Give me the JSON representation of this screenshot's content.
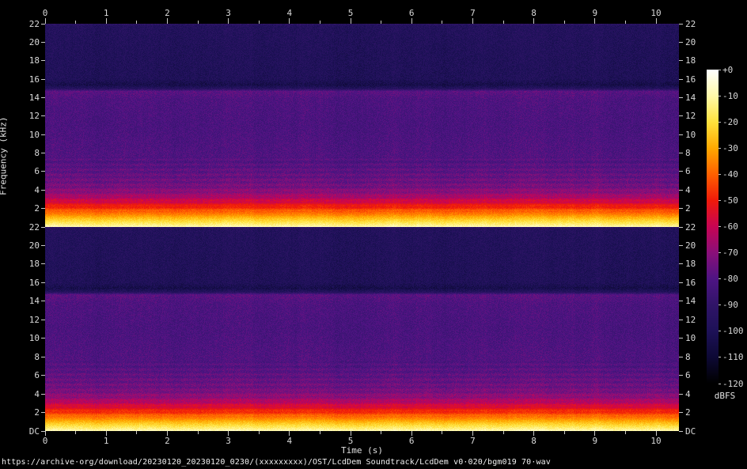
{
  "window": {
    "background": "#000000"
  },
  "status_bar": {
    "url": "https://archive·org/download/20230120_20230120_0230/(xxxxxxxxx)/OST/LcdDem Soundtrack/LcdDem v0·020/bgm019 70·wav"
  },
  "chart_data": {
    "type": "heatmap",
    "subtype": "spectrogram",
    "title": "",
    "xlabel": "Time (s)",
    "ylabel": "Frequency (kHz)",
    "duration_s": 10.38,
    "x_ticks": [
      0,
      1,
      2,
      3,
      4,
      5,
      6,
      7,
      8,
      9,
      10
    ],
    "x_minor_step_s": 0.5,
    "freq_max_khz": 22,
    "channels": [
      {
        "name": "channel-1",
        "y_tick_labels": [
          "22",
          "20",
          "18",
          "16",
          "14",
          "12",
          "10",
          "8",
          "6",
          "4",
          "2"
        ]
      },
      {
        "name": "channel-2",
        "y_tick_labels": [
          "22",
          "20",
          "18",
          "16",
          "14",
          "12",
          "10",
          "8",
          "6",
          "4",
          "2",
          "DC"
        ]
      }
    ],
    "colorbar": {
      "label": "dBFS",
      "max_db": 0,
      "min_db": -120,
      "tick_labels": [
        "+0",
        "-10",
        "-20",
        "-30",
        "-40",
        "-50",
        "-60",
        "-70",
        "-80",
        "-90",
        "-100",
        "-110",
        "-120"
      ]
    },
    "palette_db_colors": [
      [
        -120,
        "#000000"
      ],
      [
        -110,
        "#0d0935"
      ],
      [
        -100,
        "#1d1157"
      ],
      [
        -90,
        "#301468"
      ],
      [
        -80,
        "#4e1483"
      ],
      [
        -70,
        "#8a0f79"
      ],
      [
        -60,
        "#c70453"
      ],
      [
        -50,
        "#ef1a0a"
      ],
      [
        -40,
        "#ff6000"
      ],
      [
        -30,
        "#ffa800"
      ],
      [
        -20,
        "#ffe13c"
      ],
      [
        -10,
        "#fff9a8"
      ],
      [
        0,
        "#ffffff"
      ]
    ],
    "spectral_envelope_khz_db": [
      [
        22.0,
        -93
      ],
      [
        21.8,
        -97
      ],
      [
        16.0,
        -99
      ],
      [
        15.4,
        -104
      ],
      [
        15.0,
        -96
      ],
      [
        14.7,
        -78
      ],
      [
        13.8,
        -81
      ],
      [
        11.0,
        -82
      ],
      [
        7.0,
        -80
      ],
      [
        4.4,
        -74
      ],
      [
        3.5,
        -68
      ],
      [
        2.9,
        -60
      ],
      [
        2.35,
        -52
      ],
      [
        1.85,
        -44
      ],
      [
        1.35,
        -36
      ],
      [
        0.92,
        -27
      ],
      [
        0.55,
        -20
      ],
      [
        0.22,
        -14
      ],
      [
        0.0,
        -9
      ]
    ],
    "noise_db": 4
  }
}
